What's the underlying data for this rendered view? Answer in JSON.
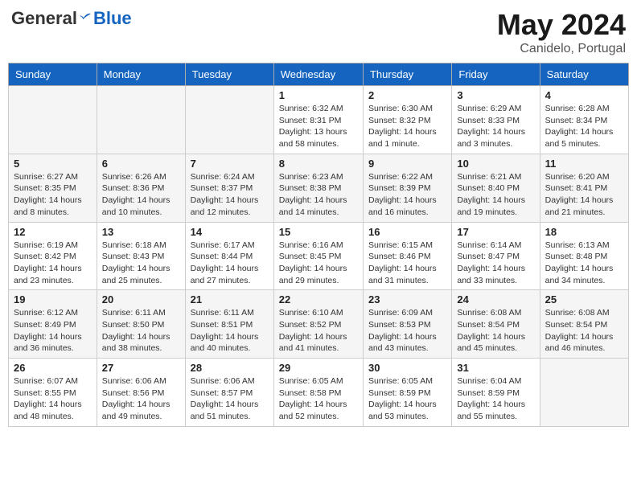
{
  "header": {
    "logo_general": "General",
    "logo_blue": "Blue",
    "month": "May 2024",
    "location": "Canidelo, Portugal"
  },
  "weekdays": [
    "Sunday",
    "Monday",
    "Tuesday",
    "Wednesday",
    "Thursday",
    "Friday",
    "Saturday"
  ],
  "weeks": [
    [
      {
        "day": "",
        "info": ""
      },
      {
        "day": "",
        "info": ""
      },
      {
        "day": "",
        "info": ""
      },
      {
        "day": "1",
        "info": "Sunrise: 6:32 AM\nSunset: 8:31 PM\nDaylight: 13 hours and 58 minutes."
      },
      {
        "day": "2",
        "info": "Sunrise: 6:30 AM\nSunset: 8:32 PM\nDaylight: 14 hours and 1 minute."
      },
      {
        "day": "3",
        "info": "Sunrise: 6:29 AM\nSunset: 8:33 PM\nDaylight: 14 hours and 3 minutes."
      },
      {
        "day": "4",
        "info": "Sunrise: 6:28 AM\nSunset: 8:34 PM\nDaylight: 14 hours and 5 minutes."
      }
    ],
    [
      {
        "day": "5",
        "info": "Sunrise: 6:27 AM\nSunset: 8:35 PM\nDaylight: 14 hours and 8 minutes."
      },
      {
        "day": "6",
        "info": "Sunrise: 6:26 AM\nSunset: 8:36 PM\nDaylight: 14 hours and 10 minutes."
      },
      {
        "day": "7",
        "info": "Sunrise: 6:24 AM\nSunset: 8:37 PM\nDaylight: 14 hours and 12 minutes."
      },
      {
        "day": "8",
        "info": "Sunrise: 6:23 AM\nSunset: 8:38 PM\nDaylight: 14 hours and 14 minutes."
      },
      {
        "day": "9",
        "info": "Sunrise: 6:22 AM\nSunset: 8:39 PM\nDaylight: 14 hours and 16 minutes."
      },
      {
        "day": "10",
        "info": "Sunrise: 6:21 AM\nSunset: 8:40 PM\nDaylight: 14 hours and 19 minutes."
      },
      {
        "day": "11",
        "info": "Sunrise: 6:20 AM\nSunset: 8:41 PM\nDaylight: 14 hours and 21 minutes."
      }
    ],
    [
      {
        "day": "12",
        "info": "Sunrise: 6:19 AM\nSunset: 8:42 PM\nDaylight: 14 hours and 23 minutes."
      },
      {
        "day": "13",
        "info": "Sunrise: 6:18 AM\nSunset: 8:43 PM\nDaylight: 14 hours and 25 minutes."
      },
      {
        "day": "14",
        "info": "Sunrise: 6:17 AM\nSunset: 8:44 PM\nDaylight: 14 hours and 27 minutes."
      },
      {
        "day": "15",
        "info": "Sunrise: 6:16 AM\nSunset: 8:45 PM\nDaylight: 14 hours and 29 minutes."
      },
      {
        "day": "16",
        "info": "Sunrise: 6:15 AM\nSunset: 8:46 PM\nDaylight: 14 hours and 31 minutes."
      },
      {
        "day": "17",
        "info": "Sunrise: 6:14 AM\nSunset: 8:47 PM\nDaylight: 14 hours and 33 minutes."
      },
      {
        "day": "18",
        "info": "Sunrise: 6:13 AM\nSunset: 8:48 PM\nDaylight: 14 hours and 34 minutes."
      }
    ],
    [
      {
        "day": "19",
        "info": "Sunrise: 6:12 AM\nSunset: 8:49 PM\nDaylight: 14 hours and 36 minutes."
      },
      {
        "day": "20",
        "info": "Sunrise: 6:11 AM\nSunset: 8:50 PM\nDaylight: 14 hours and 38 minutes."
      },
      {
        "day": "21",
        "info": "Sunrise: 6:11 AM\nSunset: 8:51 PM\nDaylight: 14 hours and 40 minutes."
      },
      {
        "day": "22",
        "info": "Sunrise: 6:10 AM\nSunset: 8:52 PM\nDaylight: 14 hours and 41 minutes."
      },
      {
        "day": "23",
        "info": "Sunrise: 6:09 AM\nSunset: 8:53 PM\nDaylight: 14 hours and 43 minutes."
      },
      {
        "day": "24",
        "info": "Sunrise: 6:08 AM\nSunset: 8:54 PM\nDaylight: 14 hours and 45 minutes."
      },
      {
        "day": "25",
        "info": "Sunrise: 6:08 AM\nSunset: 8:54 PM\nDaylight: 14 hours and 46 minutes."
      }
    ],
    [
      {
        "day": "26",
        "info": "Sunrise: 6:07 AM\nSunset: 8:55 PM\nDaylight: 14 hours and 48 minutes."
      },
      {
        "day": "27",
        "info": "Sunrise: 6:06 AM\nSunset: 8:56 PM\nDaylight: 14 hours and 49 minutes."
      },
      {
        "day": "28",
        "info": "Sunrise: 6:06 AM\nSunset: 8:57 PM\nDaylight: 14 hours and 51 minutes."
      },
      {
        "day": "29",
        "info": "Sunrise: 6:05 AM\nSunset: 8:58 PM\nDaylight: 14 hours and 52 minutes."
      },
      {
        "day": "30",
        "info": "Sunrise: 6:05 AM\nSunset: 8:59 PM\nDaylight: 14 hours and 53 minutes."
      },
      {
        "day": "31",
        "info": "Sunrise: 6:04 AM\nSunset: 8:59 PM\nDaylight: 14 hours and 55 minutes."
      },
      {
        "day": "",
        "info": ""
      }
    ]
  ]
}
